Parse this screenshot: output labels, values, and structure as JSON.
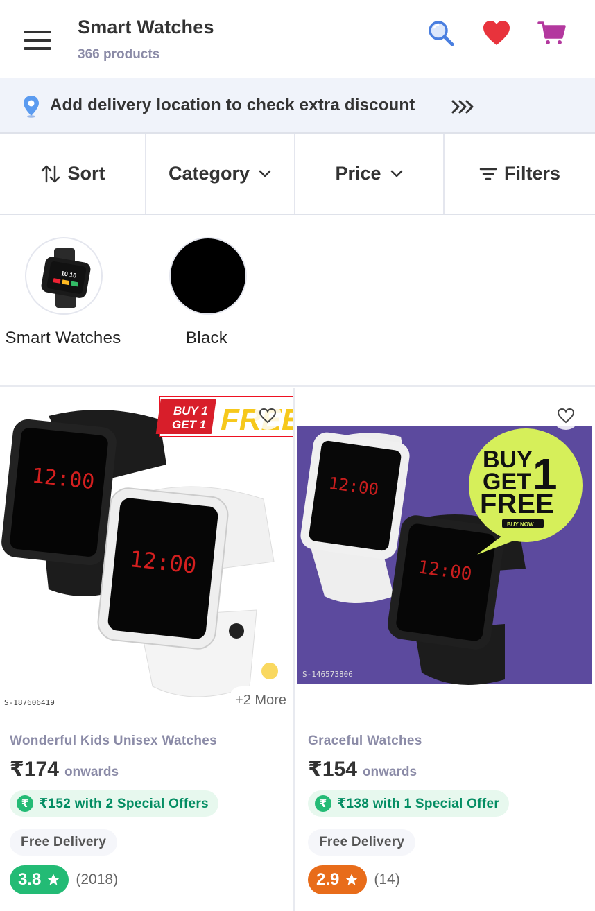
{
  "header": {
    "title": "Smart Watches",
    "subtitle": "366 products"
  },
  "delivery_banner": {
    "text": "Add delivery location to check extra discount"
  },
  "filter_bar": {
    "sort": "Sort",
    "category": "Category",
    "price": "Price",
    "filters": "Filters"
  },
  "chips": [
    {
      "label": "Smart Watches"
    },
    {
      "label": "Black"
    }
  ],
  "products": [
    {
      "name": "Wonderful Kids Unisex Watches",
      "price": "₹174",
      "price_suffix": "onwards",
      "offer": "₹152 with 2 Special Offers",
      "delivery": "Free Delivery",
      "rating": "3.8",
      "rating_count": "(2018)",
      "rating_color": "#23bb75",
      "more": "+2 More",
      "image_text": {
        "badge_line1": "BUY 1",
        "badge_line2": "GET 1",
        "badge_free": "FREE",
        "watch_time": "12:00",
        "sku": "S-187606419"
      }
    },
    {
      "name": "Graceful Watches",
      "price": "₹154",
      "price_suffix": "onwards",
      "offer": "₹138 with 1 Special Offer",
      "delivery": "Free Delivery",
      "rating": "2.9",
      "rating_count": "(14)",
      "rating_color": "#e86c1a",
      "image_text": {
        "bubble_line1": "BUY",
        "bubble_line2": "GET",
        "bubble_line3": "FREE",
        "bubble_num": "1",
        "bubble_small": "BUY NOW",
        "watch_time": "12:00",
        "sku": "S-146573806"
      }
    }
  ],
  "colors": {
    "search_icon": "#4a7fe0",
    "heart_icon": "#e8333c",
    "cart_icon": "#b3389e",
    "offer_green": "#038d63",
    "banner_bg": "#f0f3fa",
    "product2_bg": "#5c4a9e"
  }
}
